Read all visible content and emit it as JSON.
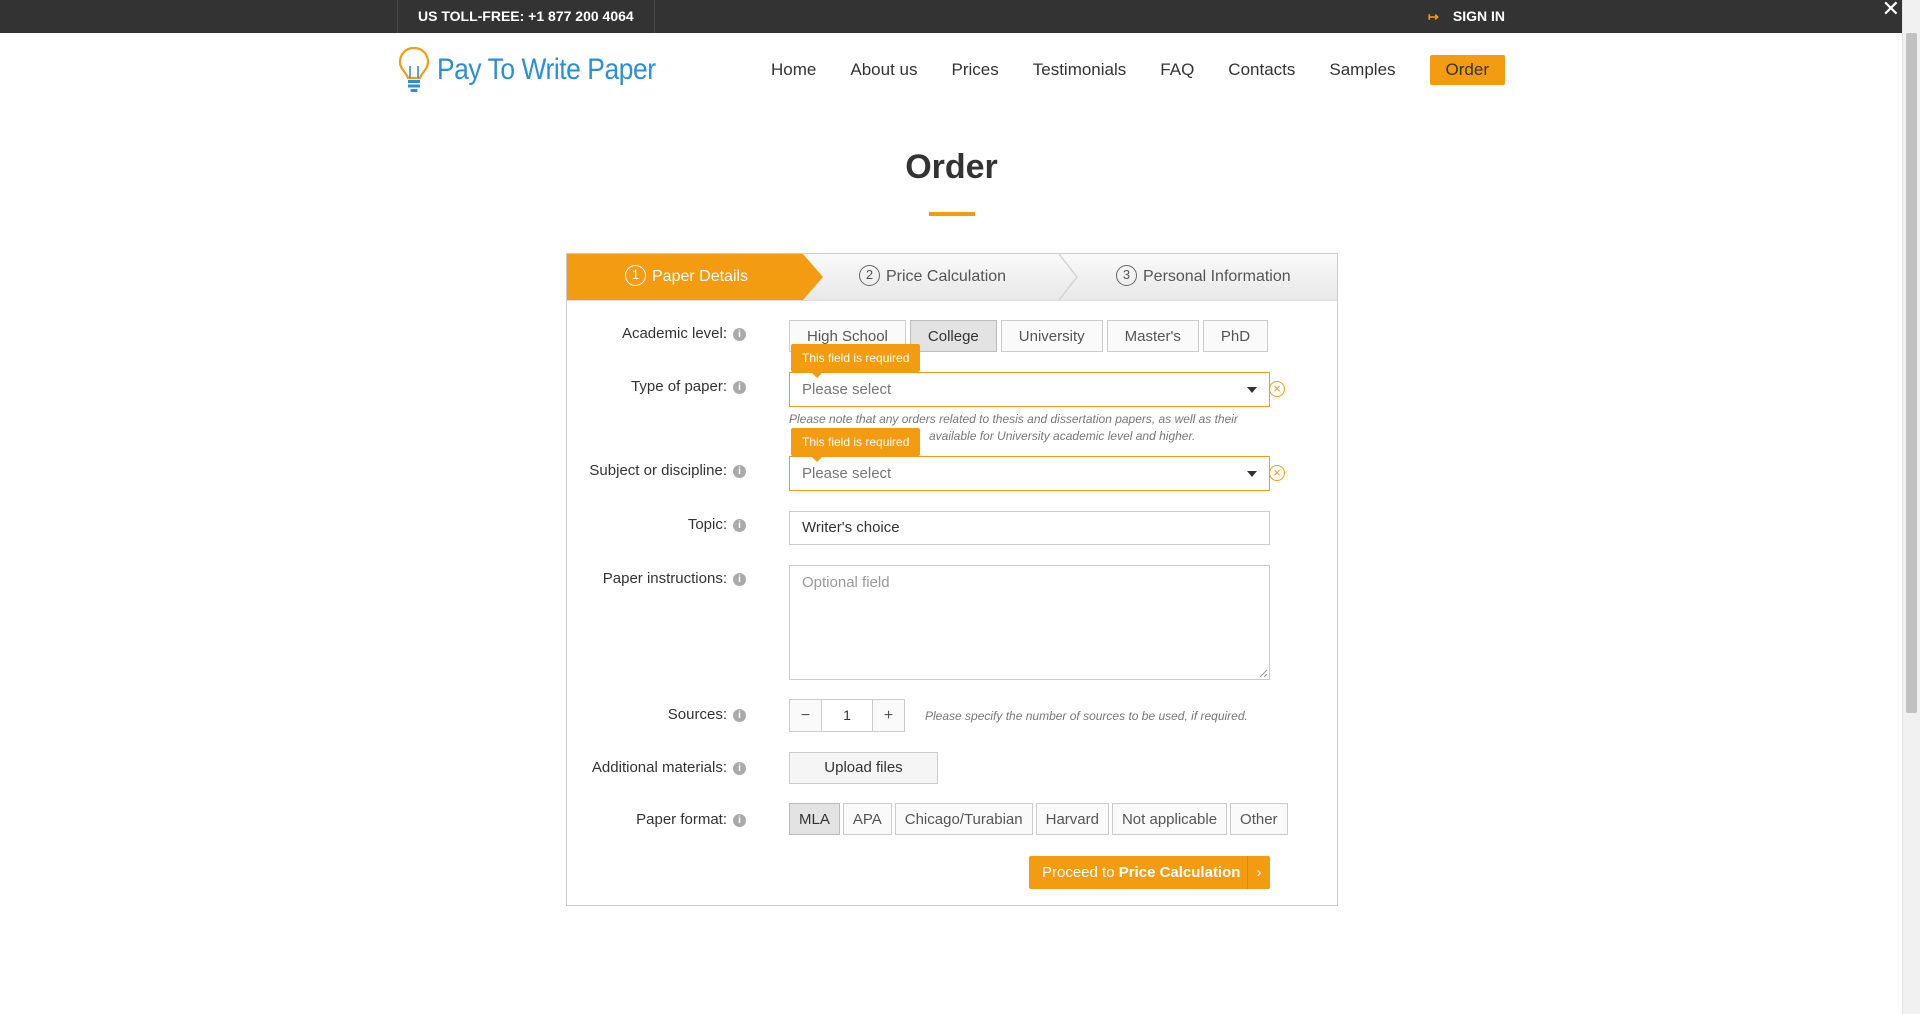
{
  "topbar": {
    "phone": "US TOLL-FREE: +1 877 200 4064",
    "signin": "SIGN IN",
    "close": "✕"
  },
  "logo": {
    "text": "Pay To Write Paper"
  },
  "nav": {
    "items": [
      "Home",
      "About us",
      "Prices",
      "Testimonials",
      "FAQ",
      "Contacts",
      "Samples"
    ],
    "order": "Order"
  },
  "page": {
    "title": "Order"
  },
  "steps": [
    {
      "num": "1",
      "label": "Paper Details"
    },
    {
      "num": "2",
      "label": "Price Calculation"
    },
    {
      "num": "3",
      "label": "Personal Information"
    }
  ],
  "form": {
    "academic_level": {
      "label": "Academic level:",
      "options": [
        "High School",
        "College",
        "University",
        "Master's",
        "PhD"
      ],
      "selected": "College"
    },
    "type_of_paper": {
      "label": "Type of paper:",
      "placeholder": "Please select",
      "error": "This field is required",
      "note_line1": "Please note that any orders related to thesis and dissertation papers, as well as their",
      "note_line2": "available for University academic level and higher."
    },
    "subject": {
      "label": "Subject or discipline:",
      "placeholder": "Please select",
      "error": "This field is required"
    },
    "topic": {
      "label": "Topic:",
      "value": "Writer's choice"
    },
    "instructions": {
      "label": "Paper instructions:",
      "placeholder": "Optional field"
    },
    "sources": {
      "label": "Sources:",
      "minus": "−",
      "value": "1",
      "plus": "+",
      "hint": "Please specify the number of sources to be used, if required."
    },
    "materials": {
      "label": "Additional materials:",
      "button": "Upload files"
    },
    "format": {
      "label": "Paper format:",
      "options": [
        "MLA",
        "APA",
        "Chicago/Turabian",
        "Harvard",
        "Not applicable",
        "Other"
      ],
      "selected": "MLA"
    },
    "proceed": {
      "prefix": "Proceed to ",
      "strong": "Price Calculation",
      "chevron": "›"
    }
  },
  "colors": {
    "accent": "#f39c12",
    "logo": "#2a8fd6",
    "topbar": "#333333"
  }
}
